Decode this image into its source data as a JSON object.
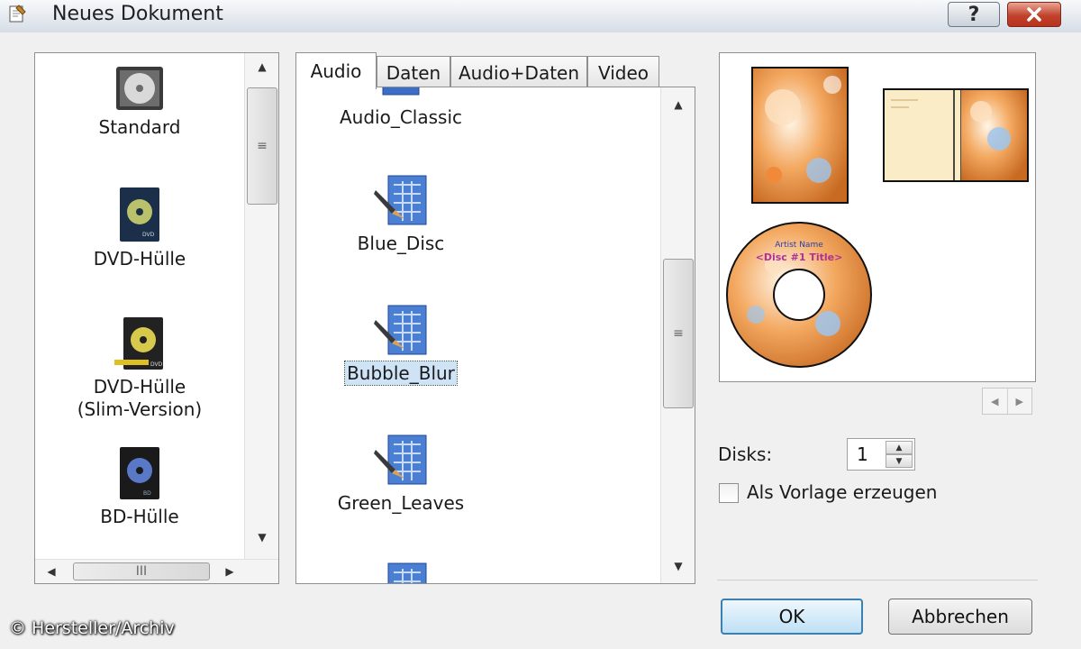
{
  "window": {
    "title": "Neues Dokument",
    "help_label": "?",
    "close_icon": "close-x-icon"
  },
  "document_types": [
    {
      "label": "Standard",
      "icon": "cd-case-icon"
    },
    {
      "label": "DVD-Hülle",
      "icon": "dvd-case-icon"
    },
    {
      "label": "DVD-Hülle\n(Slim-Version)",
      "icon": "dvd-slim-case-icon"
    },
    {
      "label": "BD-Hülle",
      "icon": "bd-case-icon"
    }
  ],
  "tabs": [
    {
      "label": "Audio",
      "active": true
    },
    {
      "label": "Daten",
      "active": false
    },
    {
      "label": "Audio+Daten",
      "active": false
    },
    {
      "label": "Video",
      "active": false
    }
  ],
  "templates": [
    {
      "label": "Audio_Classic",
      "selected": false
    },
    {
      "label": "Blue_Disc",
      "selected": false
    },
    {
      "label": "Bubble_Blur",
      "selected": true
    },
    {
      "label": "Green_Leaves",
      "selected": false
    }
  ],
  "preview": {
    "disc_text_line1": "Artist Name",
    "disc_text_line2": "<Disc #1 Title>"
  },
  "options": {
    "disks_label": "Disks:",
    "disks_value": "1",
    "as_template_label": "Als Vorlage erzeugen",
    "as_template_checked": false
  },
  "buttons": {
    "ok": "OK",
    "cancel": "Abbrechen"
  },
  "watermark": "© Hersteller/Archiv",
  "colors": {
    "selection": "#cfe3f7",
    "ok_border": "#3c7fb1",
    "close_red": "#c1432d"
  }
}
